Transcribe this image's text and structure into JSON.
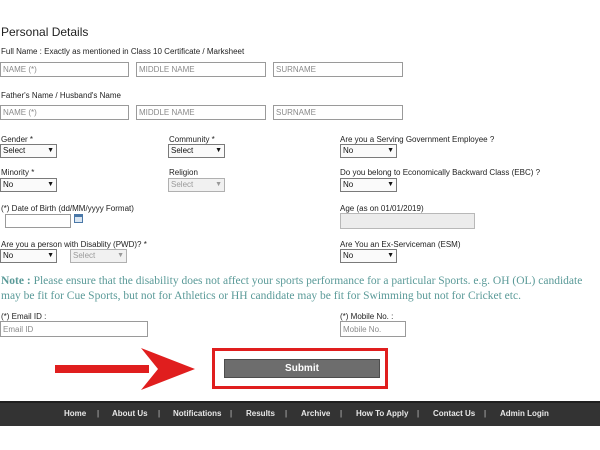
{
  "section_title": "Personal Details",
  "full_name": {
    "label": "Full Name : Exactly as mentioned in Class 10 Certificate / Marksheet",
    "first_placeholder": "NAME (*)",
    "middle_placeholder": "MIDDLE NAME",
    "surname_placeholder": "SURNAME"
  },
  "father_name": {
    "label": "Father's Name / Husband's Name",
    "first_placeholder": "NAME (*)",
    "middle_placeholder": "MIDDLE NAME",
    "surname_placeholder": "SURNAME"
  },
  "gender": {
    "label": "Gender *",
    "value": "Select"
  },
  "community": {
    "label": "Community *",
    "value": "Select"
  },
  "govt_employee": {
    "label": "Are you a Serving Government Employee ?",
    "value": "No"
  },
  "minority": {
    "label": "Minority *",
    "value": "No"
  },
  "religion": {
    "label": "Religion",
    "value": "Select"
  },
  "ebc": {
    "label": "Do you belong to Economically Backward Class (EBC) ?",
    "value": "No"
  },
  "dob": {
    "label": "(*) Date of Birth (dd/MM/yyyy Format)",
    "value": ""
  },
  "age": {
    "label": "Age (as on 01/01/2019)",
    "value": ""
  },
  "pwd": {
    "label": "Are you a person with Disablity (PWD)? *",
    "value": "No",
    "type_value": "Select"
  },
  "esm": {
    "label": "Are You an Ex-Serviceman (ESM)",
    "value": "No"
  },
  "note": {
    "prefix": "Note :",
    "text": " Please ensure that the disability does not affect your sports performance for a particular Sports. e.g. OH (OL) candidate may be fit for Cue Sports, but not for Athletics or HH candidate may be fit for Swimming but not for Cricket etc."
  },
  "email": {
    "label": "(*) Email ID :",
    "placeholder": "Email ID"
  },
  "mobile": {
    "label": "(*) Mobile No. :",
    "placeholder": "Mobile No."
  },
  "submit_label": "Submit",
  "footer_nav": [
    "Home",
    "About Us",
    "Notifications",
    "Results",
    "Archive",
    "How To Apply",
    "Contact Us",
    "Admin Login"
  ],
  "colors": {
    "note": "#5a9a98",
    "highlight": "#e01e1e",
    "footer_bg": "#333333",
    "submit_bg": "#6d6d6d"
  }
}
